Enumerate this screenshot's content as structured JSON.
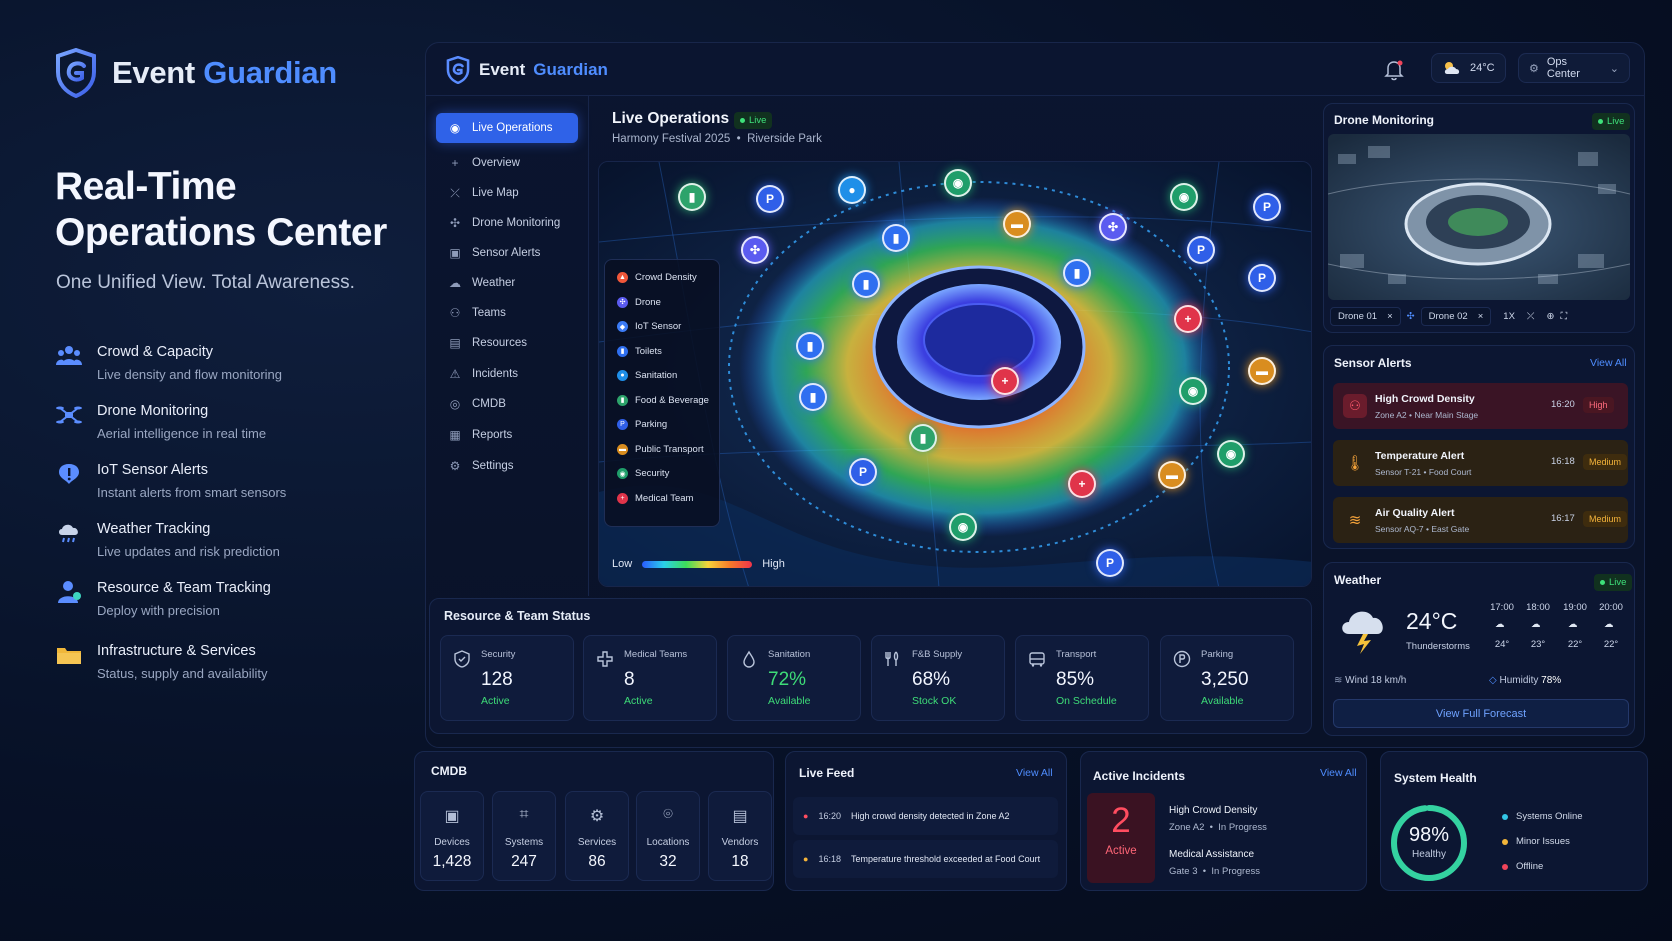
{
  "brand": {
    "name_a": "Event",
    "name_b": "Guardian"
  },
  "hero": {
    "title_line1": "Real-Time",
    "title_line2": "Operations Center",
    "subtitle": "One Unified View. Total Awareness."
  },
  "features": [
    {
      "title": "Crowd & Capacity",
      "desc": "Live density and flow monitoring",
      "icon": "crowd-icon"
    },
    {
      "title": "Drone Monitoring",
      "desc": "Aerial intelligence in real time",
      "icon": "drone-icon"
    },
    {
      "title": "IoT Sensor Alerts",
      "desc": "Instant alerts from smart sensors",
      "icon": "sensor-icon"
    },
    {
      "title": "Weather Tracking",
      "desc": "Live updates and risk prediction",
      "icon": "weather-icon"
    },
    {
      "title": "Resource & Team Tracking",
      "desc": "Deploy with precision",
      "icon": "team-icon"
    },
    {
      "title": "Infrastructure & Services",
      "desc": "Status, supply and availability",
      "icon": "folder-icon"
    }
  ],
  "header": {
    "logo_a": "Event",
    "logo_b": "Guardian",
    "temperature": "24°C",
    "workspace": "Ops Center"
  },
  "sidebar": {
    "items": [
      {
        "label": "Live Operations",
        "icon": "live-icon",
        "active": true
      },
      {
        "label": "Overview",
        "icon": "overview-icon"
      },
      {
        "label": "Live Map",
        "icon": "map-icon"
      },
      {
        "label": "Drone Monitoring",
        "icon": "drone-icon"
      },
      {
        "label": "Sensor Alerts",
        "icon": "sensor-icon"
      },
      {
        "label": "Weather",
        "icon": "cloud-icon"
      },
      {
        "label": "Teams",
        "icon": "team-icon"
      },
      {
        "label": "Resources",
        "icon": "box-icon"
      },
      {
        "label": "Incidents",
        "icon": "warning-icon"
      },
      {
        "label": "CMDB",
        "icon": "database-icon"
      },
      {
        "label": "Reports",
        "icon": "report-icon"
      },
      {
        "label": "Settings",
        "icon": "gear-icon"
      }
    ]
  },
  "live_ops": {
    "title": "Live Operations",
    "badge": "Live",
    "event": "Harmony Festival 2025",
    "venue": "Riverside Park"
  },
  "map": {
    "legend": [
      {
        "label": "Crowd Density",
        "color": "#f0573a"
      },
      {
        "label": "Drone",
        "color": "#5b5bf0"
      },
      {
        "label": "IoT Sensor",
        "color": "#3b7bf5"
      },
      {
        "label": "Toilets",
        "color": "#2f6ff0"
      },
      {
        "label": "Sanitation",
        "color": "#1f8fe8"
      },
      {
        "label": "Food & Beverage",
        "color": "#2da36b"
      },
      {
        "label": "Parking",
        "color": "#2f5fe8"
      },
      {
        "label": "Public Transport",
        "color": "#d98d1f"
      },
      {
        "label": "Security",
        "color": "#1f9e6a"
      },
      {
        "label": "Medical Team",
        "color": "#e0344a"
      }
    ],
    "scale_low": "Low",
    "scale_high": "High"
  },
  "resources": {
    "title": "Resource & Team Status",
    "cards": [
      {
        "label": "Security",
        "value": "128",
        "status": "Active",
        "icon": "shield-icon"
      },
      {
        "label": "Medical Teams",
        "value": "8",
        "status": "Active",
        "icon": "medical-cross-icon"
      },
      {
        "label": "Sanitation",
        "value": "72%",
        "status": "Available",
        "icon": "droplet-icon"
      },
      {
        "label": "F&B Supply",
        "value": "68%",
        "status": "Stock OK",
        "icon": "utensils-icon"
      },
      {
        "label": "Transport",
        "value": "85%",
        "status": "On Schedule",
        "icon": "bus-icon"
      },
      {
        "label": "Parking",
        "value": "3,250",
        "status": "Available",
        "icon": "parking-icon"
      }
    ]
  },
  "drone": {
    "title": "Drone Monitoring",
    "badge": "Live",
    "drone1": "Drone 01",
    "drone2": "Drone 02",
    "zoom": "1X"
  },
  "sensor_alerts": {
    "title": "Sensor Alerts",
    "view_all": "View All",
    "items": [
      {
        "title": "High Crowd Density",
        "sub_a": "Zone A2",
        "sub_b": "Near Main Stage",
        "time": "16:20",
        "level": "High"
      },
      {
        "title": "Temperature Alert",
        "sub_a": "Sensor T-21",
        "sub_b": "Food Court",
        "time": "16:18",
        "level": "Medium"
      },
      {
        "title": "Air Quality Alert",
        "sub_a": "Sensor AQ-7",
        "sub_b": "East Gate",
        "time": "16:17",
        "level": "Medium"
      }
    ]
  },
  "weather": {
    "title": "Weather",
    "badge": "Live",
    "temp": "24°C",
    "condition": "Thunderstorms",
    "hours": [
      {
        "time": "17:00",
        "temp": "24°"
      },
      {
        "time": "18:00",
        "temp": "23°"
      },
      {
        "time": "19:00",
        "temp": "22°"
      },
      {
        "time": "20:00",
        "temp": "22°"
      }
    ],
    "wind": "Wind 18 km/h",
    "humidity_label": "Humidity",
    "humidity": "78%",
    "button": "View Full Forecast"
  },
  "cmdb": {
    "title": "CMDB",
    "cards": [
      {
        "label": "Devices",
        "value": "1,428",
        "icon": "device-icon"
      },
      {
        "label": "Systems",
        "value": "247",
        "icon": "systems-icon"
      },
      {
        "label": "Services",
        "value": "86",
        "icon": "services-icon"
      },
      {
        "label": "Locations",
        "value": "32",
        "icon": "location-pin-icon"
      },
      {
        "label": "Vendors",
        "value": "18",
        "icon": "vendor-icon"
      }
    ]
  },
  "feed": {
    "title": "Live Feed",
    "view_all": "View All",
    "items": [
      {
        "time": "16:20",
        "text": "High crowd density detected in Zone A2"
      },
      {
        "time": "16:18",
        "text": "Temperature threshold exceeded at Food Court"
      }
    ]
  },
  "incidents": {
    "title": "Active Incidents",
    "view_all": "View All",
    "count": "2",
    "count_label": "Active",
    "items": [
      {
        "title": "High Crowd Density",
        "loc": "Zone A2",
        "status": "In Progress"
      },
      {
        "title": "Medical Assistance",
        "loc": "Gate 3",
        "status": "In Progress"
      }
    ]
  },
  "health": {
    "title": "System Health",
    "percent": "98%",
    "percent_value": 98,
    "label": "Healthy",
    "legend": [
      {
        "label": "Systems Online",
        "color": "#33c6e6"
      },
      {
        "label": "Minor Issues",
        "color": "#f3b53a"
      },
      {
        "label": "Offline",
        "color": "#f0445a"
      }
    ]
  }
}
